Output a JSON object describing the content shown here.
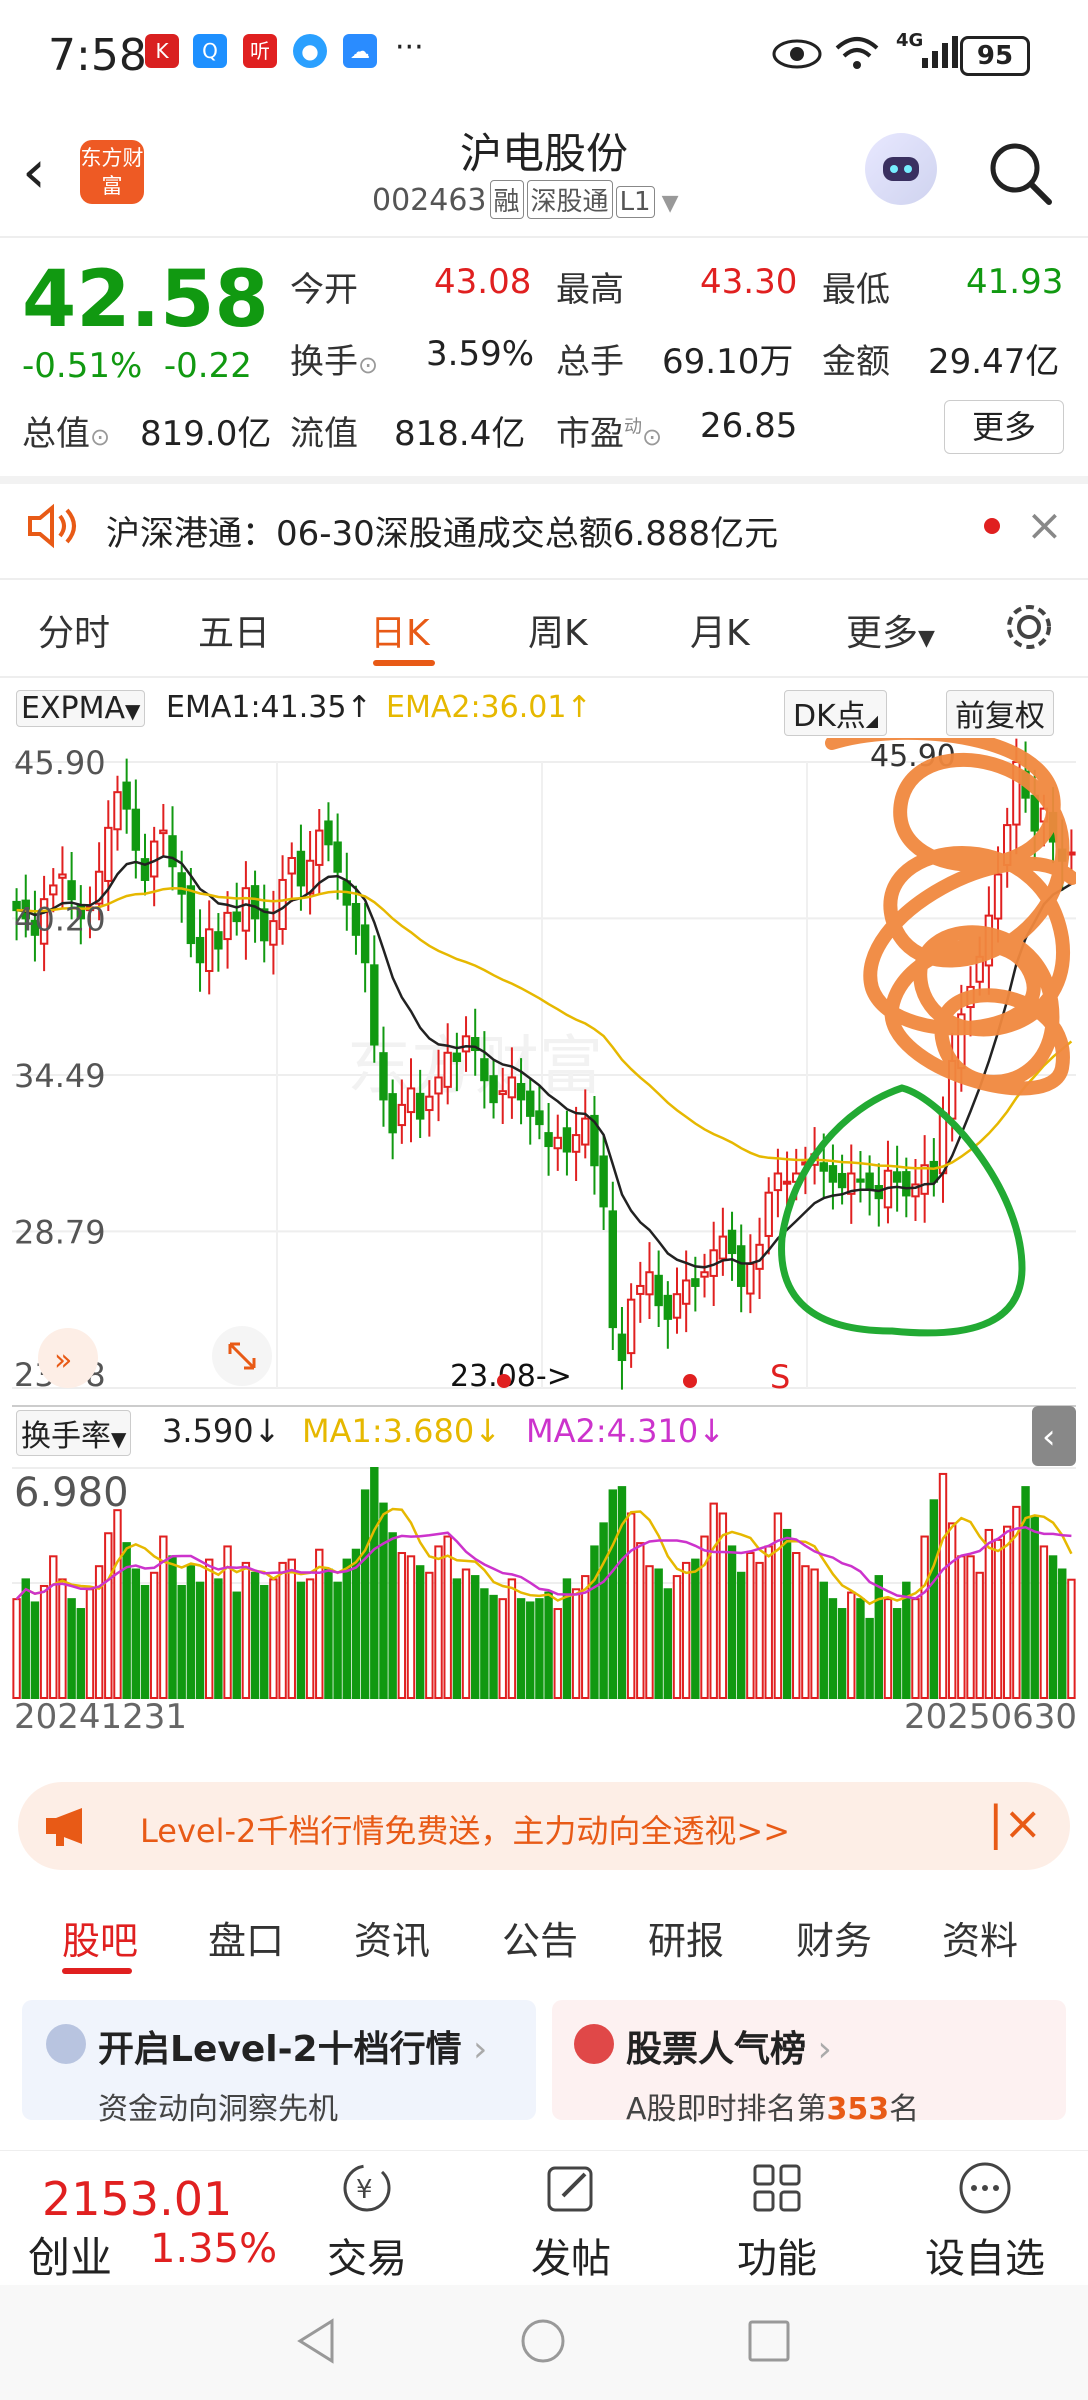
{
  "status_bar": {
    "time": "7:58",
    "network": "4G",
    "battery": "95",
    "dots": "···"
  },
  "header": {
    "logo_text": "东方财富",
    "stock_name": "沪电股份",
    "stock_code": "002463",
    "tags": [
      "融",
      "深股通",
      "L1"
    ]
  },
  "quote": {
    "price": "42.58",
    "change_pct": "-0.51%",
    "change_abs": "-0.22",
    "fields": [
      {
        "label": "今开",
        "value": "43.08",
        "color": "red"
      },
      {
        "label": "最高",
        "value": "43.30",
        "color": "red"
      },
      {
        "label": "最低",
        "value": "41.93",
        "color": "green"
      },
      {
        "label": "换手",
        "value": "3.59%",
        "color": "black"
      },
      {
        "label": "总手",
        "value": "69.10万",
        "color": "black"
      },
      {
        "label": "金额",
        "value": "29.47亿",
        "color": "black"
      },
      {
        "label": "总值",
        "value": "819.0亿",
        "color": "black"
      },
      {
        "label": "流值",
        "value": "818.4亿",
        "color": "black"
      },
      {
        "label": "市盈",
        "value": "26.85",
        "color": "black"
      }
    ],
    "pe_superscript": "动",
    "more_label": "更多"
  },
  "notice": {
    "text": "沪深港通：06-30深股通成交总额6.888亿元"
  },
  "chart_tabs": [
    "分时",
    "五日",
    "日K",
    "周K",
    "月K",
    "更多"
  ],
  "active_chart_tab": "日K",
  "indicators": {
    "main_select": "EXPMA",
    "ema1": "EMA1:41.35↑",
    "ema2": "EMA2:36.01↑",
    "dk_button": "DK点",
    "adjust_button": "前复权",
    "sub_select": "换手率",
    "sub_value": "3.590↓",
    "ma1": "MA1:3.680↓",
    "ma2": "MA2:4.310↓"
  },
  "chart_data": {
    "type": "candlestick",
    "price_ticks": [
      "45.90",
      "40.20",
      "34.49",
      "28.79",
      "23.08"
    ],
    "price_range": [
      23.08,
      45.9
    ],
    "max_label": "45.90",
    "min_annotation": "23.08->",
    "signal_label": "S",
    "turnover_max_label": "6.980",
    "turnover_range": [
      0,
      6.98
    ],
    "x_start": "20241231",
    "x_end": "20250630",
    "colors": {
      "up": "#e02020",
      "down": "#119911",
      "ema1": "#222222",
      "ema2": "#e6b800",
      "ma1": "#e6b800",
      "ma2": "#cc33cc"
    },
    "closes": [
      40.5,
      40.2,
      39.6,
      40.9,
      41.4,
      41.8,
      40.9,
      40.2,
      40.6,
      41.9,
      43.5,
      44.8,
      44.2,
      42.7,
      41.6,
      43.0,
      43.4,
      42.1,
      41.1,
      39.3,
      38.6,
      39.8,
      39.1,
      40.4,
      40.1,
      41.3,
      40.2,
      39.4,
      40.1,
      41.6,
      42.4,
      41.4,
      42.3,
      43.4,
      42.9,
      41.9,
      40.7,
      39.6,
      38.6,
      35.6,
      33.6,
      32.4,
      33.4,
      34.0,
      32.9,
      33.7,
      34.4,
      35.3,
      35.0,
      35.9,
      35.4,
      34.3,
      33.5,
      33.9,
      34.4,
      33.6,
      33.0,
      32.7,
      31.9,
      32.2,
      31.7,
      32.3,
      32.9,
      31.2,
      29.7,
      25.3,
      24.1,
      26.3,
      26.8,
      27.3,
      26.1,
      25.6,
      26.5,
      27.0,
      26.8,
      27.3,
      28.1,
      28.6,
      28.0,
      26.8,
      27.6,
      28.3,
      30.2,
      30.9,
      30.6,
      30.9,
      31.3,
      31.6,
      31.0,
      30.6,
      30.4,
      30.9,
      30.6,
      30.3,
      30.0,
      31.0,
      30.6,
      30.1,
      30.5,
      31.2,
      30.6,
      33.1,
      35.0,
      36.7,
      37.7,
      38.8,
      40.3,
      41.8,
      43.6,
      45.9,
      44.6,
      43.4,
      44.2,
      43.0,
      42.3,
      42.6
    ],
    "turnover": [
      3.0,
      3.6,
      2.9,
      3.4,
      4.3,
      3.6,
      3.0,
      2.7,
      3.3,
      4.0,
      5.0,
      5.7,
      4.7,
      3.9,
      3.4,
      3.8,
      4.9,
      4.3,
      3.4,
      4.0,
      3.5,
      4.2,
      3.6,
      4.6,
      3.2,
      4.1,
      3.8,
      3.4,
      3.6,
      4.1,
      4.2,
      3.5,
      3.6,
      4.5,
      3.9,
      3.5,
      4.2,
      4.5,
      6.3,
      6.98,
      5.9,
      5.0,
      4.4,
      4.3,
      4.0,
      3.8,
      4.6,
      4.9,
      3.6,
      3.9,
      3.7,
      3.3,
      3.1,
      3.0,
      3.6,
      3.0,
      2.9,
      3.0,
      3.2,
      2.7,
      3.6,
      3.3,
      3.7,
      4.6,
      5.3,
      6.3,
      6.4,
      5.6,
      4.7,
      4.0,
      3.9,
      3.3,
      3.7,
      4.1,
      4.2,
      4.9,
      5.9,
      5.6,
      4.6,
      3.8,
      4.4,
      4.1,
      4.6,
      5.6,
      5.1,
      4.4,
      4.0,
      3.9,
      3.5,
      3.0,
      2.7,
      3.2,
      3.0,
      2.4,
      3.7,
      3.0,
      2.7,
      3.5,
      3.0,
      4.9,
      6.0,
      6.8,
      5.3,
      4.3,
      4.3,
      3.8,
      5.1,
      4.8,
      5.2,
      5.8,
      6.4,
      5.5,
      4.6,
      4.3,
      3.9,
      3.59
    ]
  },
  "promo_banner": {
    "text": "Level-2千档行情免费送，主力动向全透视>>"
  },
  "bottom_tabs": [
    "股吧",
    "盘口",
    "资讯",
    "公告",
    "研报",
    "财务",
    "资料"
  ],
  "active_bottom_tab": "股吧",
  "cards": [
    {
      "title": "开启Level-2十档行情",
      "sub": "资金动向洞察先机"
    },
    {
      "title": "股票人气榜",
      "sub_prefix": "A股即时排名第",
      "rank": "353",
      "sub_suffix": "名"
    }
  ],
  "bottom_nav": {
    "index_value": "2153.01",
    "index_name": "创业",
    "index_change": "1.35%",
    "items": [
      "交易",
      "发帖",
      "功能",
      "设自选"
    ]
  }
}
